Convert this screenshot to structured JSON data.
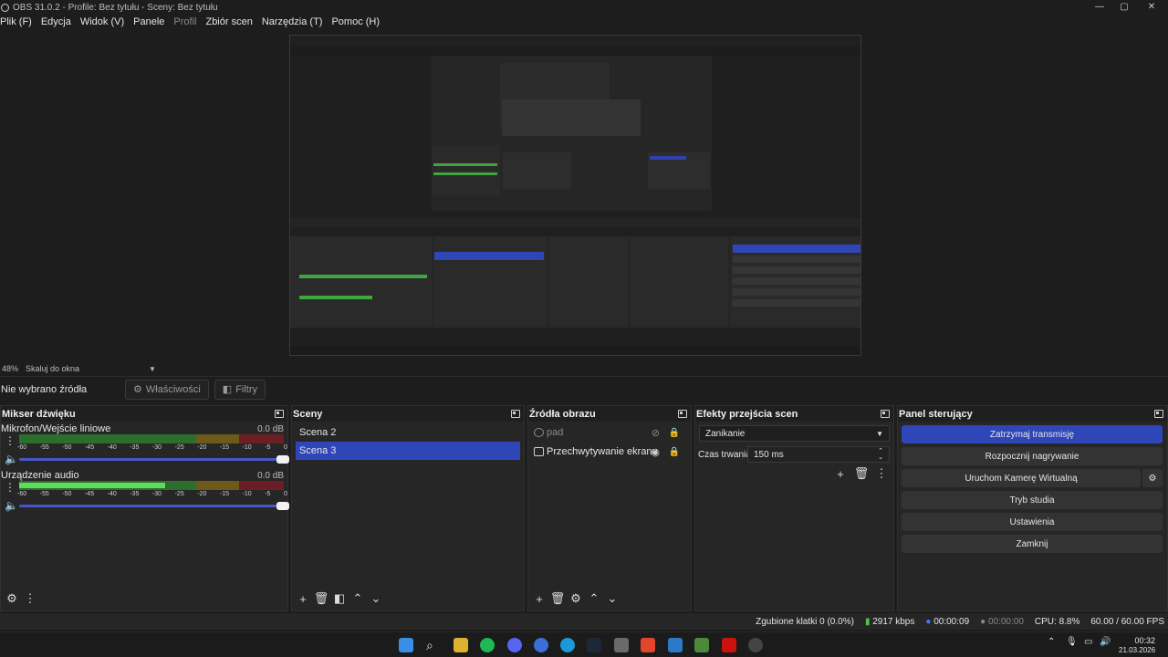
{
  "window": {
    "title": "OBS 31.0.2 - Profile: Bez tytułu - Sceny: Bez tytułu",
    "controls": [
      "—",
      "▢",
      "✕"
    ]
  },
  "menu": [
    "Plik (F)",
    "Edycja",
    "Widok (V)",
    "Panele",
    "Profil",
    "Zbiór scen",
    "Narzędzia (T)",
    "Pomoc (H)"
  ],
  "zoom": {
    "value": "48%",
    "mode": "Skaluj do okna"
  },
  "source_toolbar": {
    "status": "Nie wybrano źródła",
    "properties": "Właściwości",
    "filters": "Filtry"
  },
  "mixer": {
    "title": "Mikser dźwięku",
    "channels": [
      {
        "name": "Mikrofon/Wejście liniowe",
        "db": "0.0 dB",
        "level": 0.0
      },
      {
        "name": "Urządzenie audio",
        "db": "0.0 dB",
        "level": 0.55
      }
    ],
    "ticks": [
      "-60",
      "-55",
      "-50",
      "-45",
      "-40",
      "-35",
      "-30",
      "-25",
      "-20",
      "-15",
      "-10",
      "-5",
      "0"
    ]
  },
  "scenes": {
    "title": "Sceny",
    "items": [
      "Scena 2",
      "Scena 3"
    ],
    "selected": "Scena 3"
  },
  "sources": {
    "title": "Źródła obrazu",
    "items": [
      {
        "name": "pad",
        "dim": true
      },
      {
        "name": "Przechwytywanie ekranu",
        "dim": false
      }
    ]
  },
  "transitions": {
    "title": "Efekty przejścia scen",
    "type": "Zanikanie",
    "duration_label": "Czas trwania",
    "duration": "150 ms"
  },
  "controls": {
    "title": "Panel sterujący",
    "buttons": [
      "Zatrzymaj transmisję",
      "Rozpocznij nagrywanie",
      "Uruchom Kamerę Wirtualną",
      "Tryb studia",
      "Ustawienia",
      "Zamknij"
    ]
  },
  "status": {
    "dropped": "Zgubione klatki 0 (0.0%)",
    "bitrate": "2917 kbps",
    "stream_time": "00:00:09",
    "rec_time": "00:00:00",
    "cpu": "CPU: 8.8%",
    "fps": "60.00 / 60.00 FPS"
  },
  "taskbar": {
    "time": "00:32",
    "date": "21.03.2026"
  },
  "colors": {
    "accent": "#2f46b8",
    "panel": "#262626",
    "bg": "#1d1d1d"
  }
}
